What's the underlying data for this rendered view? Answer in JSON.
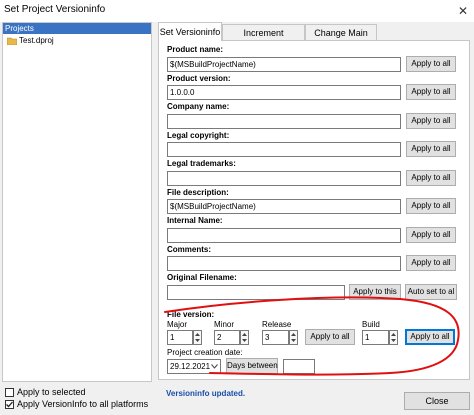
{
  "window": {
    "title": "Set Project Versioninfo"
  },
  "tree": {
    "header": "Projects",
    "items": [
      "Test.dproj"
    ]
  },
  "tabs": [
    "Set Versioninfo",
    "Increment Versioninfo",
    "Change Main Icon"
  ],
  "fields": {
    "product_name": {
      "label": "Product name:",
      "value": "$(MSBuildProjectName)"
    },
    "product_version": {
      "label": "Product version:",
      "value": "1.0.0.0"
    },
    "company_name": {
      "label": "Company name:",
      "value": ""
    },
    "legal_copyright": {
      "label": "Legal copyright:",
      "value": ""
    },
    "legal_trademarks": {
      "label": "Legal trademarks:",
      "value": ""
    },
    "file_description": {
      "label": "File description:",
      "value": "$(MSBuildProjectName)"
    },
    "internal_name": {
      "label": "Internal Name:",
      "value": ""
    },
    "comments": {
      "label": "Comments:",
      "value": ""
    },
    "original_filename": {
      "label": "Original Filename:",
      "value": ""
    }
  },
  "buttons": {
    "apply_to_all": "Apply to all",
    "apply_to_this": "Apply to this",
    "auto_set_to_all": "Auto set to al",
    "days_between": "Days between",
    "close": "Close"
  },
  "file_version": {
    "label": "File version:",
    "major": {
      "label": "Major",
      "value": "1"
    },
    "minor": {
      "label": "Minor",
      "value": "2"
    },
    "release": {
      "label": "Release",
      "value": "3"
    },
    "build": {
      "label": "Build",
      "value": "1"
    }
  },
  "creation_date": {
    "label": "Project creation date:",
    "value": "29.12.2021",
    "days_value": ""
  },
  "footer": {
    "apply_to_selected": {
      "label": "Apply to selected",
      "checked": false
    },
    "apply_all_platforms": {
      "label": "Apply VersionInfo to all platforms",
      "checked": true
    },
    "status": "Versioninfo updated."
  },
  "annotation_color": "#e01010"
}
